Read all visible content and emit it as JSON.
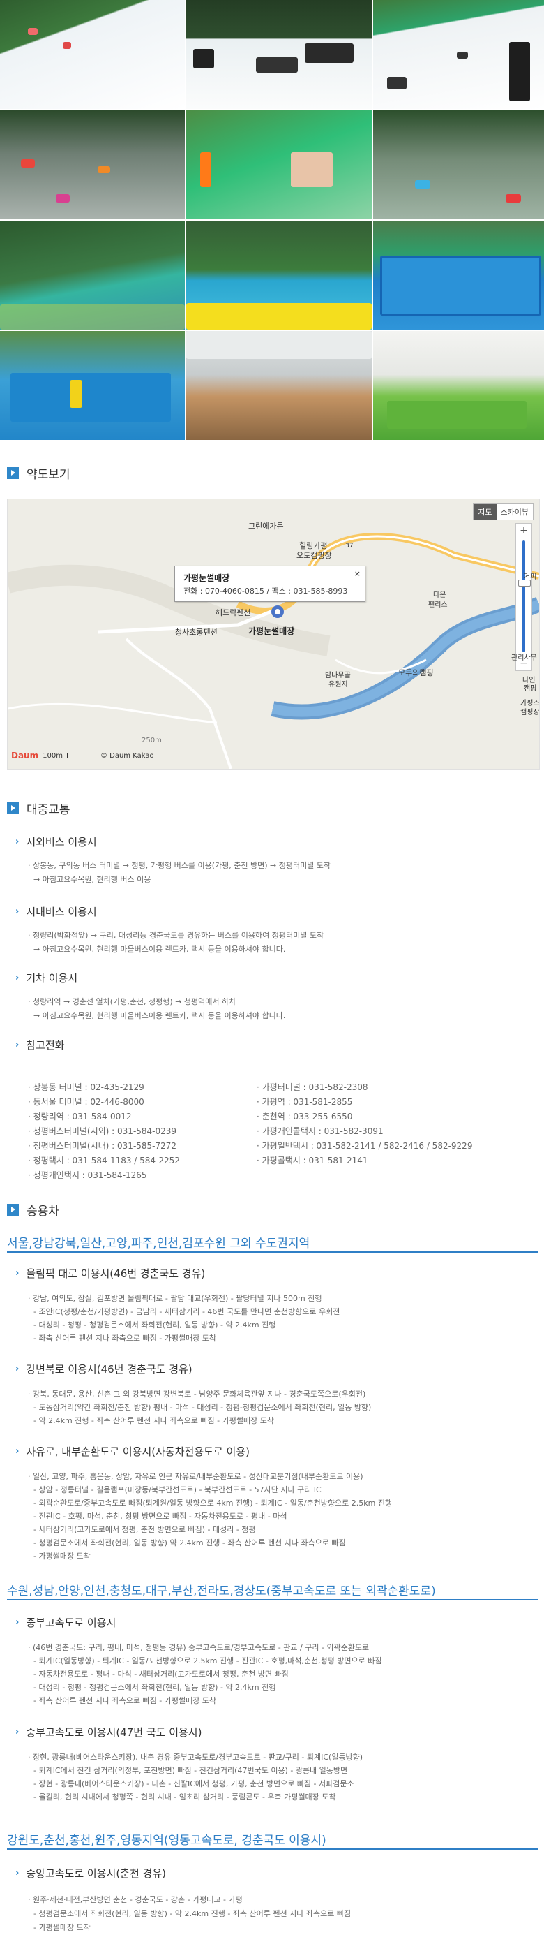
{
  "colors": {
    "accent": "#2f87c9",
    "region_title": "#2f7fc6",
    "text": "#666666"
  },
  "gallery": [
    {
      "alt": "snow-sled-slope-1"
    },
    {
      "alt": "snow-sled-slope-2"
    },
    {
      "alt": "snow-sled-slope-3"
    },
    {
      "alt": "water-sled-mist-1"
    },
    {
      "alt": "water-sled-mist-2"
    },
    {
      "alt": "water-sled-mist-3"
    },
    {
      "alt": "green-slide"
    },
    {
      "alt": "water-slide-pool"
    },
    {
      "alt": "outdoor-pool"
    },
    {
      "alt": "kids-pool"
    },
    {
      "alt": "restaurant-hall"
    },
    {
      "alt": "cafeteria-green-chairs"
    }
  ],
  "sections": {
    "map": "약도보기",
    "transit": "대중교통",
    "car": "승용차"
  },
  "map": {
    "btn_map": "지도",
    "btn_sky": "스카이뷰",
    "zoom_in": "+",
    "zoom_out": "−",
    "popup_name": "가평눈썰매장",
    "popup_info": "전화 : 070-4060-0815 / 팩스 : 031-585-8993",
    "popup_close": "×",
    "labels": {
      "l1": "그린에가든",
      "l2": "힐링가평",
      "l3": "오토캠핑장",
      "l4": "37",
      "l5": "헤드락펜션",
      "l6": "청사초롱펜션",
      "l7": "가평눈썰매장",
      "l8": "모두의캠핑",
      "l9": "다온",
      "l10": "펜리스",
      "l11": "밤나무골",
      "l12": "유원지",
      "l13": "관리사무",
      "l14": "가평스",
      "l15": "캠핑장",
      "l16": "250m",
      "l17": "다인",
      "l18": "캠핑",
      "l19": "거피"
    },
    "scale": {
      "logo": "Daum",
      "dist": "100m",
      "copyright": "© Daum Kakao"
    }
  },
  "transit": {
    "city_bus": {
      "title": "시외버스 이용시",
      "lines": [
        "상봉동, 구의동 버스 터미널 → 청평, 가평행 버스를 이용(가평, 춘천 방면) → 청평터미널 도착",
        "→ 아침고요수목원, 현리행 버스 이용"
      ]
    },
    "local_bus": {
      "title": "시내버스 이용시",
      "lines": [
        "청량리(박화점앞) → 구리, 대성리등 경춘국도를 경유하는 버스를 이용하여 청평터미널 도착",
        "→ 아침고요수목원, 현리행 마을버스이용 렌트카, 택시 등을 이용하셔야 합니다."
      ]
    },
    "train": {
      "title": "기차 이용시",
      "lines": [
        "청량리역 → 경춘선 열차(가평,춘천, 청평행) → 청평역에서 하차",
        "→ 아침고요수목원, 현리행 마을버스이용 렌트카, 택시 등을 이용하셔야 합니다."
      ]
    },
    "phones_title": "참고전화",
    "phones_left": [
      "상봉동 터미널 : 02-435-2129",
      "동서울 터미널 : 02-446-8000",
      "청량리역 : 031-584-0012",
      "청평버스터미널(시외) : 031-584-0239",
      "청평버스터미널(시내) : 031-585-7272",
      "청평택시 : 031-584-1183 / 584-2252",
      "청평개인택시 : 031-584-1265"
    ],
    "phones_right": [
      "가평터미널 : 031-582-2308",
      "가평역 : 031-581-2855",
      "춘천역 : 033-255-6550",
      "가평개인콜택시 : 031-582-3091",
      "가평일반택시 : 031-582-2141 / 582-2416 / 582-9229",
      "가평콜택시 : 031-581-2141"
    ]
  },
  "car": {
    "region1": "서울,강남강북,일산,고양,파주,인천,김포수원 그외 수도권지역",
    "r1_routes": [
      {
        "title": "올림픽 대로 이용시(46번 경춘국도 경유)",
        "lines": [
          "강남, 여의도, 잠실, 김포방면 올림픽대로 - 팔당 대교(우회전) - 팔당터널 지나 500m 진행",
          "- 조안IC(청평/춘천/가평방면) - 금남리 - 새터삼거리 - 46번 국도를 만나면 춘천방향으로 우회전",
          "- 대성리 - 청평 - 청평검문소에서 좌회전(현리, 일동 방향) - 약 2.4km 진행",
          "- 좌측 산어루 펜션 지나 좌측으로 빠짐 - 가평썰매장 도착"
        ]
      },
      {
        "title": "강변북로 이용시(46번 경춘국도 경유)",
        "lines": [
          "강북, 동대문, 용산, 신촌 그 외 강북방면 강변북로 - 남양주 문화체육관앞 지나 - 경춘국도쪽으로(우회전)",
          "- 도농삼거리(약간 좌회전/춘천 방향) 평내 - 마석 - 대성리 - 청평-청평검문소에서 좌회전(현리, 일동 방향)",
          "- 약 2.4km 진행 - 좌측 산어루 펜션 지나 좌측으로 빠짐 - 가평썰매장 도착"
        ]
      },
      {
        "title": "자유로, 내부순환도로 이용시(자동차전용도로 이용)",
        "lines": [
          "일산, 고양, 파주, 홍은동, 상암, 자유로 인근 자유로/내부순환도로 - 성산대교분기점(내부순환도로 이용)",
          "- 상암 - 정릉터널 - 길음램프(마장동/북부간선도로) - 북부간선도로 - 57사단 지나 구리 IC",
          "- 외곽순환도로/중부고속도로 빠짐(퇴계원/일동 방향으로 4km 진행) - 퇴계IC - 일동/춘천방향으로 2.5km 진행",
          "- 진관IC - 호평, 마석, 춘천, 청평 방면으로 빠짐 - 자동차전용도로 - 평내 - 마석",
          "- 새터삼거리(고가도로에서 청평, 춘천 방면으로 빠짐) - 대성리 - 청평",
          "- 청평검문소에서 좌회전(현리, 일동 방향) 약 2.4km 진행 - 좌측 산어루 펜션 지나 좌측으로 빠짐",
          "- 가평썰매장 도착"
        ]
      }
    ],
    "region2": "수원,성남,안양,인천,충청도,대구,부산,전라도,경상도(중부고속도로 또는 외곽순환도로)",
    "r2_routes": [
      {
        "title": "중부고속도로 이용시",
        "lines": [
          "(46번 경춘국도: 구리, 평내, 마석, 청평등 경유) 중부고속도로/경부고속도로 - 판교 / 구리 - 외곽순환도로",
          "- 퇴계IC(일동방향) - 퇴계IC - 일동/포천방향으로 2.5km 진행 - 진관IC - 호평,마석,춘천,청평 방면으로 빠짐",
          "- 자동차전용도로 - 평내 - 마석 - 새터삼거리(고가도로에서 청평, 춘천 방면 빠짐",
          "- 대성리 - 청평 - 청평검문소에서 좌회전(현리, 일동 방향) - 약 2.4km 진행",
          "- 좌측 산어루 펜션 지나 좌측으로 빠짐 - 가평썰매장 도착"
        ]
      },
      {
        "title": "중부고속도로 이용시(47번 국도 이용시)",
        "lines": [
          "장현, 광릉내(베어스타운스키장), 내촌 경유 중부고속도로/경부고속도로 - 판교/구리 - 퇴계IC(일동방향)",
          "- 퇴계IC에서 진건 삼거리(의정부, 포천방면) 빠짐 - 진건삼거리(47번국도 이용) - 광릉내 일동방면",
          "- 장현 - 광릉내(베어스타운스키장) - 내촌 - 신팔IC에서 청평, 가평, 춘천 방면으로 빠짐 - 서파검문소",
          "- 율길리, 현리 시내에서 청평쪽 - 현리 시내 - 임초리 삼거리 - 풍림콘도 - 우측 가평썰매장 도착"
        ]
      }
    ],
    "region3": "강원도,춘천,홍천,원주,영동지역(영동고속도로, 경춘국도 이용시)",
    "r3_routes": [
      {
        "title": "중앙고속도로 이용시(춘천 경유)",
        "lines": [
          "원주·제천·대전,부산방면 춘천 - 경춘국도 - 강촌 - 가평대교 - 가평",
          "- 청평검문소에서 좌회전(현리, 일동 방향) - 약 2.4km 진행 - 좌측 산어루 펜션 지나 좌측으로 빠짐",
          "- 가평썰매장 도착"
        ]
      }
    ]
  }
}
